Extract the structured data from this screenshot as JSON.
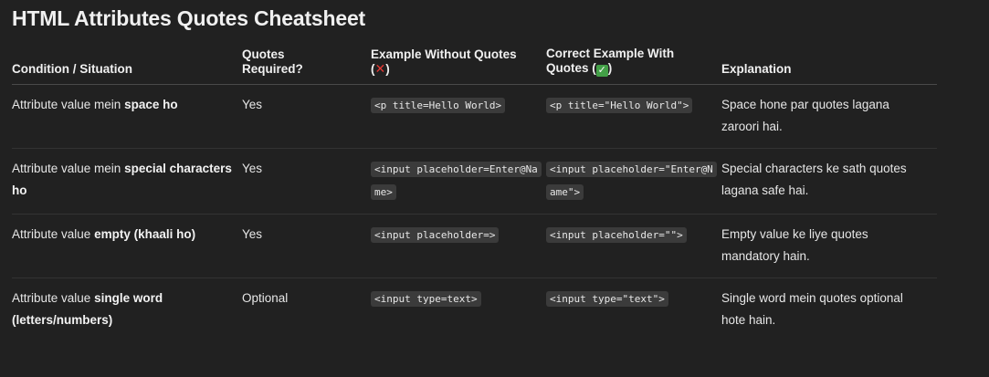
{
  "title": "HTML Attributes Quotes Cheatsheet",
  "table": {
    "headers": {
      "condition": "Condition / Situation",
      "required_line1": "Quotes",
      "required_line2": "Required?",
      "without_line1": "Example Without Quotes",
      "without_open": "(",
      "without_icon": "✕",
      "without_close": ")",
      "with_line1": "Correct Example With",
      "with_open": "Quotes (",
      "with_icon": "✓",
      "with_close": ")",
      "explanation": "Explanation"
    },
    "rows": [
      {
        "cond_prefix": "Attribute value mein ",
        "cond_bold": "space ho",
        "required": "Yes",
        "without": "<p title=Hello World>",
        "with": "<p title=\"Hello World\">",
        "explanation": "Space hone par quotes lagana zaroori hai."
      },
      {
        "cond_prefix": "Attribute value mein ",
        "cond_bold": "special characters ho",
        "required": "Yes",
        "without": "<input placeholder=Enter@Name>",
        "with": "<input placeholder=\"Enter@Name\">",
        "explanation": "Special characters ke sath quotes lagana safe hai."
      },
      {
        "cond_prefix": "Attribute value ",
        "cond_bold": "empty (khaali ho)",
        "required": "Yes",
        "without": "<input placeholder=>",
        "with": "<input placeholder=\"\">",
        "explanation": "Empty value ke liye quotes mandatory hain."
      },
      {
        "cond_prefix": "Attribute value ",
        "cond_bold": "single word (letters/numbers)",
        "required": "Optional",
        "without": "<input type=text>",
        "with": "<input type=\"text\">",
        "explanation": "Single word mein quotes optional hote hain."
      }
    ]
  },
  "icons": {
    "cross": "cross-mark-icon",
    "check": "check-mark-icon",
    "cross_color": "#e53935",
    "check_color": "#43a047"
  }
}
